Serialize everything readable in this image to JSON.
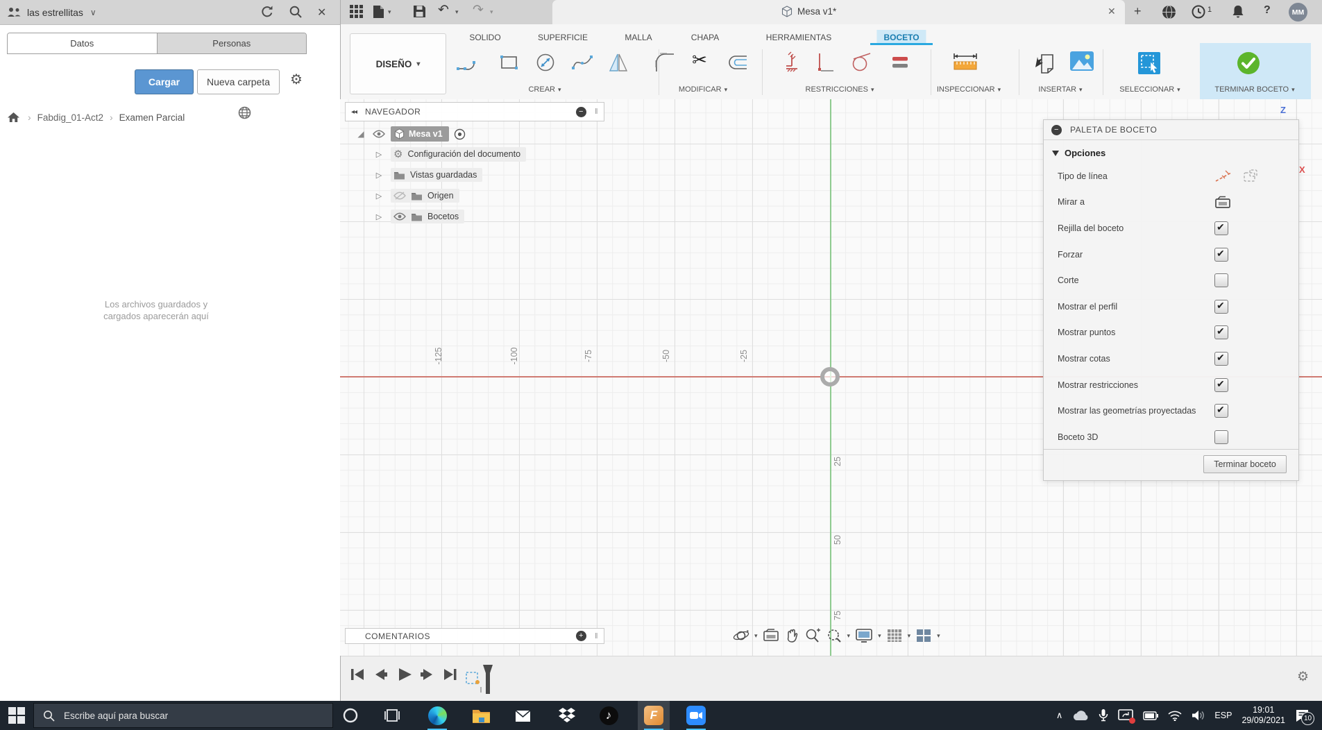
{
  "icons": {
    "caret_down": "▾",
    "vee": "∨",
    "plus": "+",
    "minus": "−",
    "question": "?",
    "close": "✕",
    "chevrons_left": "◂◂",
    "grip": "‖",
    "chevron_up": "∧",
    "gear": "⚙",
    "scissors": "✂",
    "note": "♪",
    "undo": "↶",
    "redo": "↷",
    "expand_root": "◢",
    "expand": "▷",
    "crumb_sep": "›"
  },
  "data_panel": {
    "team_name": "las estrellitas",
    "tab_datos": "Datos",
    "tab_personas": "Personas",
    "upload": "Cargar",
    "new_folder": "Nueva carpeta",
    "crumb_1": "Fabdig_01-Act2",
    "crumb_2": "Examen Parcial",
    "empty_line1": "Los archivos guardados y",
    "empty_line2": "cargados aparecerán aquí"
  },
  "titlebar": {
    "doc_tab": "Mesa v1*",
    "clock_badge": "1",
    "avatar": "MM"
  },
  "ribbon": {
    "design": "DISEÑO",
    "tab_solido": "SOLIDO",
    "tab_superficie": "SUPERFICIE",
    "tab_malla": "MALLA",
    "tab_chapa": "CHAPA",
    "tab_herramientas": "HERRAMIENTAS",
    "tab_boceto": "BOCETO",
    "grp_crear": "CREAR",
    "grp_modificar": "MODIFICAR",
    "grp_restricciones": "RESTRICCIONES",
    "grp_inspeccionar": "INSPECCIONAR",
    "grp_insertar": "INSERTAR",
    "grp_seleccionar": "SELECCIONAR",
    "grp_terminar": "TERMINAR BOCETO"
  },
  "navigator": {
    "title": "NAVEGADOR",
    "root": "Mesa v1",
    "item_1": "Configuración del documento",
    "item_2": "Vistas guardadas",
    "item_3": "Origen",
    "item_4": "Bocetos"
  },
  "palette": {
    "title": "PALETA DE BOCETO",
    "section": "Opciones",
    "rows": [
      {
        "label": "Tipo de línea",
        "checked": false
      },
      {
        "label": "Mirar a",
        "checked": false
      },
      {
        "label": "Rejilla del boceto",
        "checked": true
      },
      {
        "label": "Forzar",
        "checked": true
      },
      {
        "label": "Corte",
        "checked": false
      },
      {
        "label": "Mostrar el perfil",
        "checked": true
      },
      {
        "label": "Mostrar puntos",
        "checked": true
      },
      {
        "label": "Mostrar cotas",
        "checked": true
      },
      {
        "label": "Mostrar restricciones",
        "checked": true
      },
      {
        "label": "Mostrar las geometrías proyectadas",
        "checked": true
      },
      {
        "label": "Boceto 3D",
        "checked": false
      }
    ],
    "finish": "Terminar boceto"
  },
  "canvas": {
    "x_label": "X",
    "z_label": "Z",
    "h_ticks": [
      "-125",
      "-100",
      "-75",
      "-50",
      "-25"
    ],
    "v_ticks": [
      "25",
      "50",
      "75"
    ]
  },
  "comments": {
    "title": "COMENTARIOS"
  },
  "taskbar": {
    "search_placeholder": "Escribe aquí para buscar",
    "lang": "ESP",
    "time": "19:01",
    "date": "29/09/2021",
    "badge": "10"
  }
}
